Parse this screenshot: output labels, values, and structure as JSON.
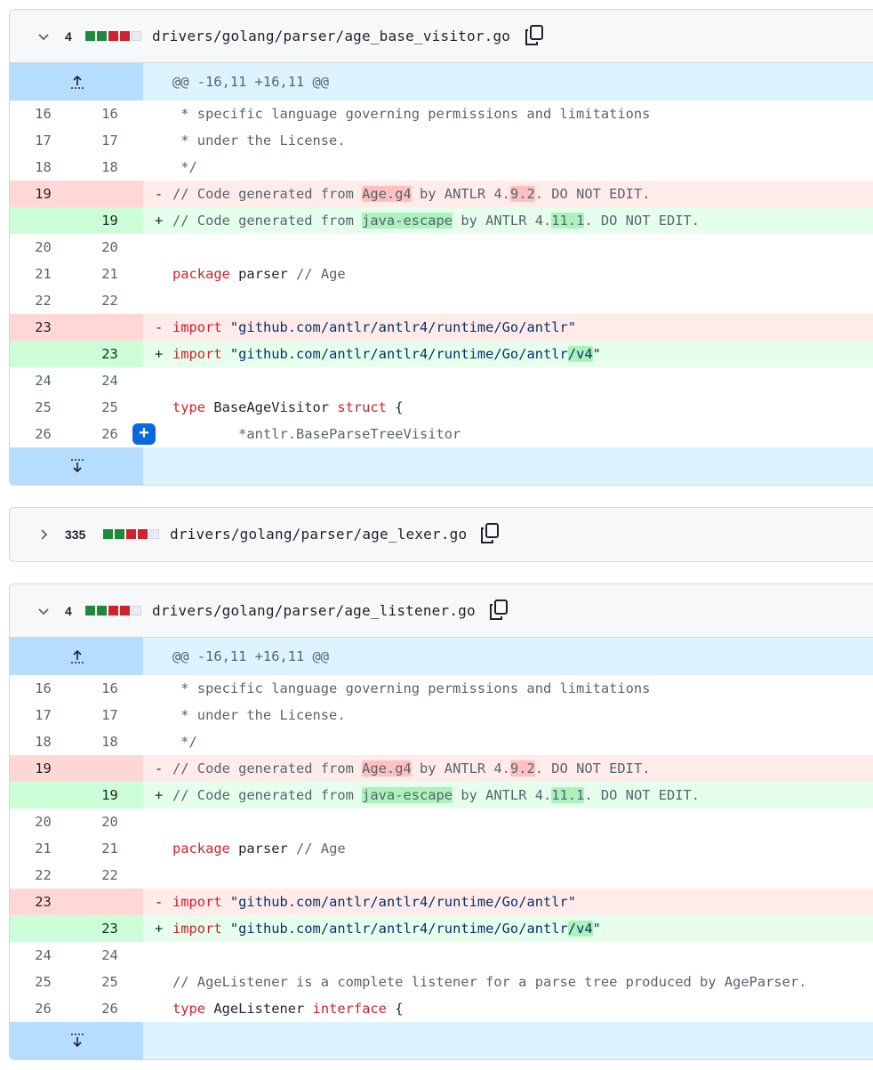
{
  "files": [
    {
      "count": "4",
      "blocks": [
        "g",
        "g",
        "r",
        "r",
        "n"
      ],
      "path": "drivers/golang/parser/age_base_visitor.go",
      "expanded": true,
      "hunk": "@@ -16,11 +16,11 @@",
      "lines": [
        {
          "t": "ctx",
          "o": "16",
          "n": "16",
          "code": " * specific language governing permissions and limitations"
        },
        {
          "t": "ctx",
          "o": "17",
          "n": "17",
          "code": " * under the License."
        },
        {
          "t": "ctx",
          "o": "18",
          "n": "18",
          "code": " */"
        },
        {
          "t": "del",
          "o": "19",
          "n": "",
          "mark": "-",
          "code": "// Code generated from Age.g4 by ANTLR 4.9.2. DO NOT EDIT."
        },
        {
          "t": "add",
          "o": "",
          "n": "19",
          "mark": "+",
          "code": "// Code generated from java-escape by ANTLR 4.11.1. DO NOT EDIT."
        },
        {
          "t": "ctx",
          "o": "20",
          "n": "20",
          "code": ""
        },
        {
          "t": "ctx",
          "o": "21",
          "n": "21",
          "code": "package parser // Age"
        },
        {
          "t": "ctx",
          "o": "22",
          "n": "22",
          "code": ""
        },
        {
          "t": "del",
          "o": "23",
          "n": "",
          "mark": "-",
          "code": "import \"github.com/antlr/antlr4/runtime/Go/antlr\""
        },
        {
          "t": "add",
          "o": "",
          "n": "23",
          "mark": "+",
          "code": "import \"github.com/antlr/antlr4/runtime/Go/antlr/v4\""
        },
        {
          "t": "ctx",
          "o": "24",
          "n": "24",
          "code": ""
        },
        {
          "t": "ctx",
          "o": "25",
          "n": "25",
          "code": "type BaseAgeVisitor struct {"
        },
        {
          "t": "ctx",
          "o": "26",
          "n": "26",
          "code": "\t*antlr.BaseParseTreeVisitor",
          "plus": true
        }
      ]
    },
    {
      "count": "335",
      "blocks": [
        "g",
        "g",
        "r",
        "r",
        "n"
      ],
      "path": "drivers/golang/parser/age_lexer.go",
      "expanded": false
    },
    {
      "count": "4",
      "blocks": [
        "g",
        "g",
        "r",
        "r",
        "n"
      ],
      "path": "drivers/golang/parser/age_listener.go",
      "expanded": true,
      "hunk": "@@ -16,11 +16,11 @@",
      "lines": [
        {
          "t": "ctx",
          "o": "16",
          "n": "16",
          "code": " * specific language governing permissions and limitations"
        },
        {
          "t": "ctx",
          "o": "17",
          "n": "17",
          "code": " * under the License."
        },
        {
          "t": "ctx",
          "o": "18",
          "n": "18",
          "code": " */"
        },
        {
          "t": "del",
          "o": "19",
          "n": "",
          "mark": "-",
          "code": "// Code generated from Age.g4 by ANTLR 4.9.2. DO NOT EDIT."
        },
        {
          "t": "add",
          "o": "",
          "n": "19",
          "mark": "+",
          "code": "// Code generated from java-escape by ANTLR 4.11.1. DO NOT EDIT."
        },
        {
          "t": "ctx",
          "o": "20",
          "n": "20",
          "code": ""
        },
        {
          "t": "ctx",
          "o": "21",
          "n": "21",
          "code": "package parser // Age"
        },
        {
          "t": "ctx",
          "o": "22",
          "n": "22",
          "code": ""
        },
        {
          "t": "del",
          "o": "23",
          "n": "",
          "mark": "-",
          "code": "import \"github.com/antlr/antlr4/runtime/Go/antlr\""
        },
        {
          "t": "add",
          "o": "",
          "n": "23",
          "mark": "+",
          "code": "import \"github.com/antlr/antlr4/runtime/Go/antlr/v4\""
        },
        {
          "t": "ctx",
          "o": "24",
          "n": "24",
          "code": ""
        },
        {
          "t": "ctx",
          "o": "25",
          "n": "25",
          "code": "// AgeListener is a complete listener for a parse tree produced by AgeParser."
        },
        {
          "t": "ctx",
          "o": "26",
          "n": "26",
          "code": "type AgeListener interface {"
        }
      ]
    }
  ],
  "colors": {
    "added": "#1f883d",
    "removed": "#cf222e",
    "accent": "#0969da"
  }
}
